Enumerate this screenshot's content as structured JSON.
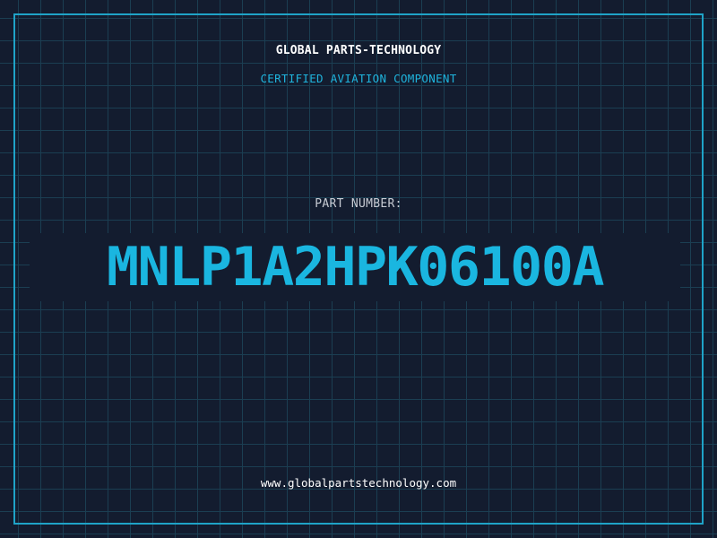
{
  "header": {
    "company": "GLOBAL PARTS-TECHNOLOGY",
    "subtitle": "CERTIFIED AVIATION COMPONENT"
  },
  "part": {
    "label": "PART NUMBER:",
    "number": "MNLP1A2HPK06100A"
  },
  "footer": {
    "website": "www.globalpartstechnology.com"
  },
  "colors": {
    "background": "#131c2f",
    "grid": "#1b3e52",
    "accent": "#1fa3c7",
    "part_number": "#1ab6e0"
  }
}
